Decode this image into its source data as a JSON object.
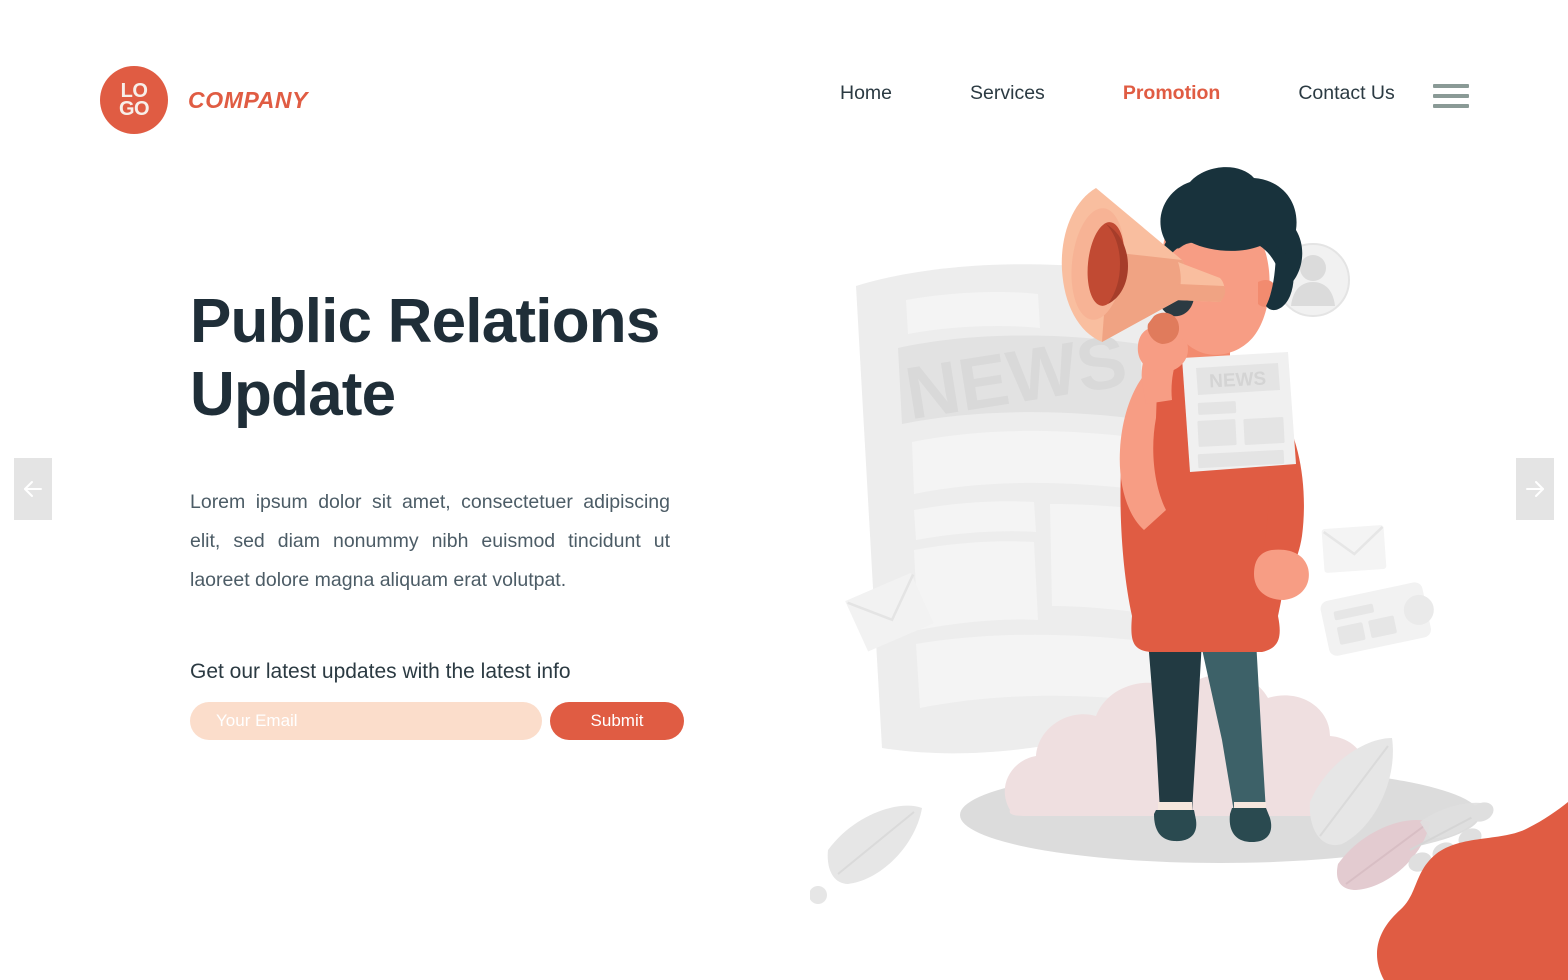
{
  "header": {
    "logo": {
      "line1": "LO",
      "line2": "GO",
      "icon": "logo-circle-icon"
    },
    "brand_name": "COMPANY",
    "nav": [
      {
        "label": "Home",
        "active": false
      },
      {
        "label": "Services",
        "active": false
      },
      {
        "label": "Promotion",
        "active": true
      },
      {
        "label": "Contact Us",
        "active": false
      }
    ],
    "menu_icon": "hamburger-menu-icon"
  },
  "hero": {
    "headline": "Public Relations Update",
    "headline_line1": "Public Relations",
    "headline_line2": "Update",
    "paragraph": "Lorem ipsum dolor sit amet, consectetuer adipiscing elit, sed diam nonummy nibh euismod tincidunt ut laoreet dolore magna aliquam erat volutpat.",
    "form_label": "Get our latest updates with the latest info",
    "email_placeholder": "Your Email",
    "email_value": "",
    "submit_label": "Submit"
  },
  "carousel": {
    "prev_icon": "arrow-left-icon",
    "next_icon": "arrow-right-icon",
    "prev_label": "←",
    "next_label": "→"
  },
  "illustration": {
    "name": "man-with-megaphone-illustration",
    "newspaper_text": "NEWS",
    "held_paper_text": "NEWS",
    "avatar_icon": "user-avatar-icon",
    "envelope_icon": "envelope-icon"
  },
  "colors": {
    "accent": "#E05C43",
    "accent_light": "#FBDDCB",
    "heading": "#1F2E38",
    "body_text": "#4C5C66",
    "nav_text": "#2B3A42",
    "hamburger": "#8A9A96",
    "arrow_bg": "#E4E4E4",
    "skin": "#F79D84",
    "shirt": "#E05C43",
    "pants_dark": "#223A42",
    "pants_light": "#3D6168",
    "hair": "#18323C",
    "paper_gray": "#E3E3E3",
    "ground": "#DCDCDC",
    "bush_pink": "#EFDFE0",
    "background": "#FFFFFF"
  }
}
